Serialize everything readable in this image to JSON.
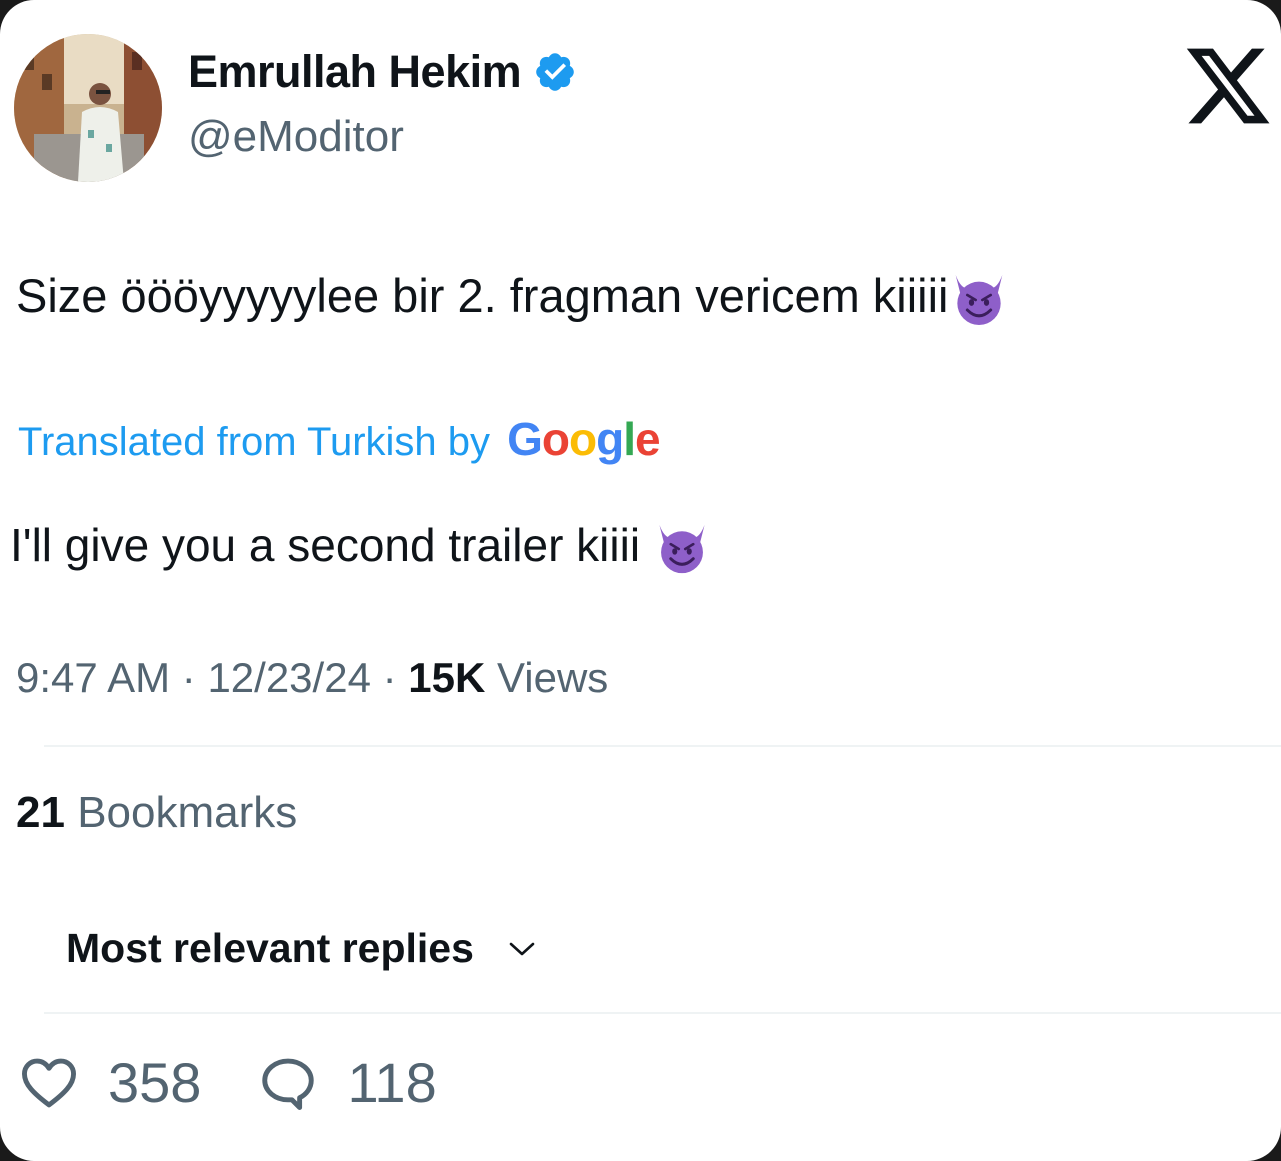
{
  "tweet": {
    "author_name": "Emrullah Hekim",
    "handle": "@eModitor",
    "text": "Size öööyyyyylee bir 2. fragman vericem kiiiii",
    "translated_label": "Translated from Turkish by",
    "translator_brand": [
      "G",
      "o",
      "o",
      "g",
      "l",
      "e"
    ],
    "translation": "I'll give you a second trailer kiiii",
    "time": "9:47 AM",
    "date": "12/23/24",
    "views_count": "15K",
    "views_label": "Views",
    "bookmarks_count": "21",
    "bookmarks_label": "Bookmarks",
    "replies_sort": "Most relevant replies",
    "likes": "358",
    "replies": "118"
  },
  "icons": {
    "verified": "verified-badge-icon",
    "platform": "x-logo-icon",
    "emoji": "smiling-devil-emoji",
    "like": "heart-icon",
    "reply": "speech-bubble-icon",
    "sort": "chevron-down-icon"
  },
  "colors": {
    "accent": "#1d9bf0",
    "text": "#0f1419",
    "secondary": "#536471",
    "emoji": "#8e5fc9"
  }
}
